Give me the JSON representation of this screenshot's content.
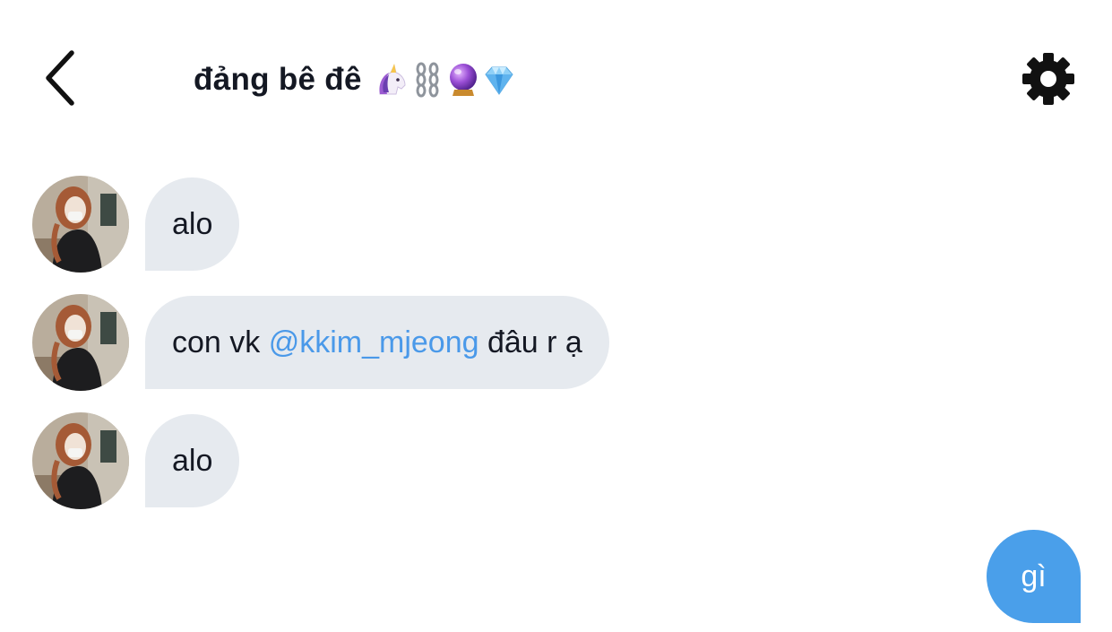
{
  "header": {
    "title": "đảng bê đê",
    "title_emojis": [
      "unicorn-emoji",
      "chain-emoji",
      "crystal-ball-emoji",
      "gem-emoji"
    ],
    "back_icon": "chevron-left-icon",
    "settings_icon": "gear-icon"
  },
  "messages": [
    {
      "direction": "incoming",
      "text": "alo"
    },
    {
      "direction": "incoming",
      "text_before": "con vk ",
      "mention": "@kkim_mjeong",
      "text_after": " đâu r ạ"
    },
    {
      "direction": "incoming",
      "text": "alo"
    },
    {
      "direction": "outgoing",
      "text": "gì"
    }
  ],
  "colors": {
    "incoming_bubble": "#e6eaef",
    "outgoing_bubble": "#4a9fea",
    "mention": "#4a99e9",
    "text": "#141823"
  }
}
